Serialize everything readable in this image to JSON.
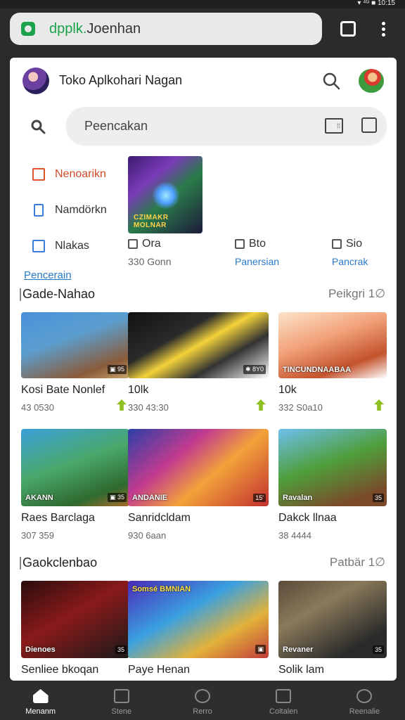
{
  "status": {
    "right_text": "▾ ⁴ᴳ ■ 10:15"
  },
  "browser": {
    "url_host": "dpplk.",
    "url_rest": "Joenhan"
  },
  "app": {
    "title": "Toko Aplkohari Nagan"
  },
  "search": {
    "placeholder": "Peencakan",
    "filter_label": "⁞⁞"
  },
  "side_menu": {
    "items": [
      {
        "label": "Nenoarikn"
      },
      {
        "label": "Namdörkn"
      },
      {
        "label": "Nlakas"
      }
    ],
    "link": "Pencerain"
  },
  "featured": {
    "caption": "CZIMAKR MOLNAR"
  },
  "mini_items": [
    {
      "title": "Ora",
      "sub": "330 Gonn",
      "sub_style": "grey"
    },
    {
      "title": "Bto",
      "sub": "Panersian",
      "sub_style": "link"
    },
    {
      "title": "Sio",
      "sub": "Pancrak",
      "sub_style": "link"
    }
  ],
  "sections": [
    {
      "title": "Gade-Nahao",
      "more": "Peikgri 1∅",
      "cards": [
        {
          "title": "Kosi Bate Nonlef",
          "meta": "43 0530",
          "label": "",
          "tag": "▣ 95",
          "arrow": true
        },
        {
          "title": "10lk",
          "meta": "330 43:30",
          "label": "",
          "tag": "✱ 8Y0",
          "arrow": true
        },
        {
          "title": "10k",
          "meta": "332 S0a10",
          "label": "TINCUNDNAABAA",
          "tag": "",
          "arrow": true
        },
        {
          "title": "Raes Barclaga",
          "meta": "307 359",
          "label": "AKANN",
          "tag": "▣ 35",
          "arrow": false
        },
        {
          "title": "Sanridcldam",
          "meta": "930 6aan",
          "label": "ANDANIE",
          "tag": "15'",
          "arrow": false
        },
        {
          "title": "Dakck llnaa",
          "meta": "38 4444",
          "label": "Ravalan",
          "tag": "35",
          "arrow": false
        }
      ]
    },
    {
      "title": "Gaokclenbao",
      "more": "Patbär 1∅",
      "cards": [
        {
          "title": "Senliee bkoqan",
          "meta": "",
          "label": "Dienoes",
          "tag": "35",
          "arrow": false
        },
        {
          "title": "Paye Henan",
          "meta": "",
          "label": "Somsé BMNIAN",
          "tag": "▣",
          "arrow": false
        },
        {
          "title": "Solik lam",
          "meta": "",
          "label": "Revaner",
          "tag": "35",
          "arrow": false
        }
      ]
    }
  ],
  "bottom_nav": [
    {
      "label": "Menanm",
      "active": true
    },
    {
      "label": "Stene",
      "active": false
    },
    {
      "label": "Rerro",
      "active": false
    },
    {
      "label": "Coltalen",
      "active": false
    },
    {
      "label": "Reenalie",
      "active": false
    }
  ]
}
